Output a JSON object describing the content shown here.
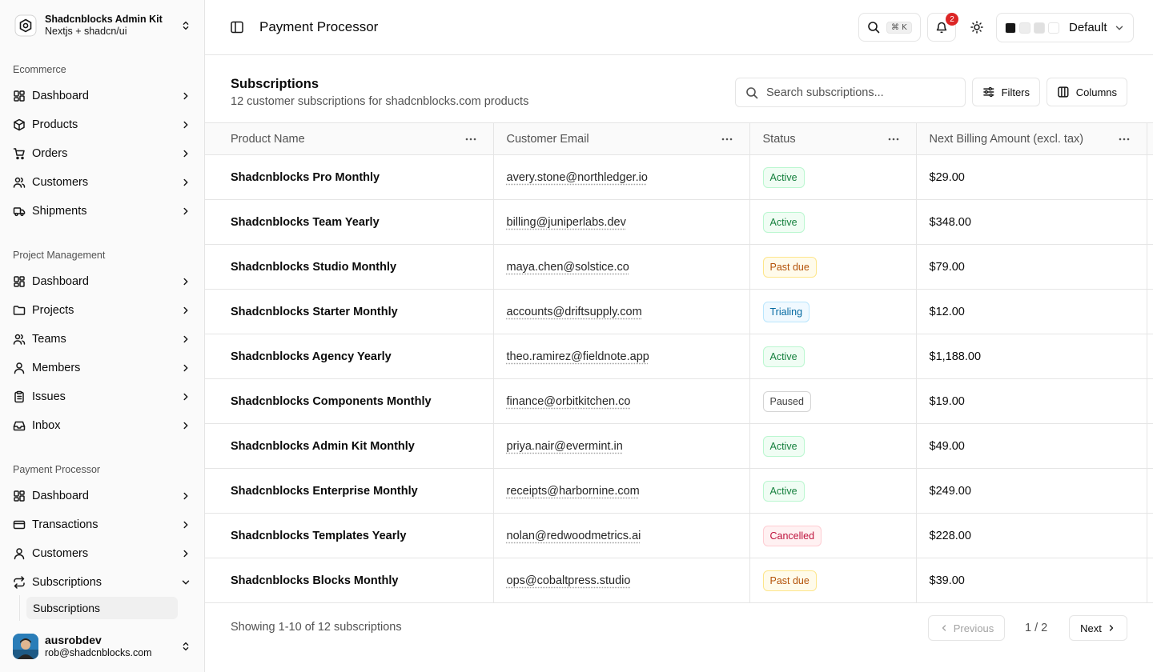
{
  "org": {
    "name": "Shadcnblocks Admin Kit",
    "subtitle": "Nextjs + shadcn/ui"
  },
  "sidebar": {
    "groups": [
      {
        "label": "Ecommerce",
        "items": [
          {
            "label": "Dashboard",
            "icon": "layout-dashboard-icon"
          },
          {
            "label": "Products",
            "icon": "package-icon"
          },
          {
            "label": "Orders",
            "icon": "shopping-cart-icon"
          },
          {
            "label": "Customers",
            "icon": "users-icon"
          },
          {
            "label": "Shipments",
            "icon": "truck-icon"
          }
        ]
      },
      {
        "label": "Project Management",
        "items": [
          {
            "label": "Dashboard",
            "icon": "layout-dashboard-icon"
          },
          {
            "label": "Projects",
            "icon": "folder-icon"
          },
          {
            "label": "Teams",
            "icon": "users-icon"
          },
          {
            "label": "Members",
            "icon": "user-icon"
          },
          {
            "label": "Issues",
            "icon": "clipboard-list-icon"
          },
          {
            "label": "Inbox",
            "icon": "inbox-icon"
          }
        ]
      },
      {
        "label": "Payment Processor",
        "items": [
          {
            "label": "Dashboard",
            "icon": "layout-dashboard-icon"
          },
          {
            "label": "Transactions",
            "icon": "credit-card-icon"
          },
          {
            "label": "Customers",
            "icon": "user-icon"
          },
          {
            "label": "Subscriptions",
            "icon": "repeat-icon",
            "expanded": true,
            "sub_items": [
              "Subscriptions"
            ]
          }
        ]
      }
    ]
  },
  "user": {
    "name": "ausrobdev",
    "email": "rob@shadcnblocks.com"
  },
  "header": {
    "title": "Payment Processor",
    "shortcut": "⌘ K",
    "notification_count": "2",
    "theme": "Default",
    "swatch_colors": [
      "#171717",
      "#ededed",
      "#e0e0e0",
      "#ffffff"
    ]
  },
  "subscriptions": {
    "title": "Subscriptions",
    "description": "12 customer subscriptions for shadcnblocks.com products",
    "search_placeholder": "Search subscriptions...",
    "filters_label": "Filters",
    "columns_label": "Columns",
    "columns": [
      "Product Name",
      "Customer Email",
      "Status",
      "Next Billing Amount (excl. tax)"
    ],
    "rows": [
      {
        "product": "Shadcnblocks Pro Monthly",
        "email": "avery.stone@northledger.io",
        "status": "Active",
        "amount": "$29.00"
      },
      {
        "product": "Shadcnblocks Team Yearly",
        "email": "billing@juniperlabs.dev",
        "status": "Active",
        "amount": "$348.00"
      },
      {
        "product": "Shadcnblocks Studio Monthly",
        "email": "maya.chen@solstice.co",
        "status": "Past due",
        "amount": "$79.00"
      },
      {
        "product": "Shadcnblocks Starter Monthly",
        "email": "accounts@driftsupply.com",
        "status": "Trialing",
        "amount": "$12.00"
      },
      {
        "product": "Shadcnblocks Agency Yearly",
        "email": "theo.ramirez@fieldnote.app",
        "status": "Active",
        "amount": "$1,188.00"
      },
      {
        "product": "Shadcnblocks Components Monthly",
        "email": "finance@orbitkitchen.co",
        "status": "Paused",
        "amount": "$19.00"
      },
      {
        "product": "Shadcnblocks Admin Kit Monthly",
        "email": "priya.nair@evermint.in",
        "status": "Active",
        "amount": "$49.00"
      },
      {
        "product": "Shadcnblocks Enterprise Monthly",
        "email": "receipts@harbornine.com",
        "status": "Active",
        "amount": "$249.00"
      },
      {
        "product": "Shadcnblocks Templates Yearly",
        "email": "nolan@redwoodmetrics.ai",
        "status": "Cancelled",
        "amount": "$228.00"
      },
      {
        "product": "Shadcnblocks Blocks Monthly",
        "email": "ops@cobaltpress.studio",
        "status": "Past due",
        "amount": "$39.00"
      }
    ],
    "status_colors": {
      "Active": {
        "fg": "#15803d",
        "bg": "#f0fdf4",
        "border": "#bbf7d0"
      },
      "Past due": {
        "fg": "#b45309",
        "bg": "#fffbeb",
        "border": "#fde68a"
      },
      "Trialing": {
        "fg": "#0369a1",
        "bg": "#f0f9ff",
        "border": "#bae6fd"
      },
      "Paused": {
        "fg": "#404040",
        "bg": "#ffffff",
        "border": "#d4d4d4"
      },
      "Cancelled": {
        "fg": "#be123c",
        "bg": "#fff1f2",
        "border": "#fecdd3"
      }
    }
  },
  "pagination": {
    "summary": "Showing 1-10 of 12 subscriptions",
    "previous": "Previous",
    "page": "1 / 2",
    "next": "Next"
  }
}
